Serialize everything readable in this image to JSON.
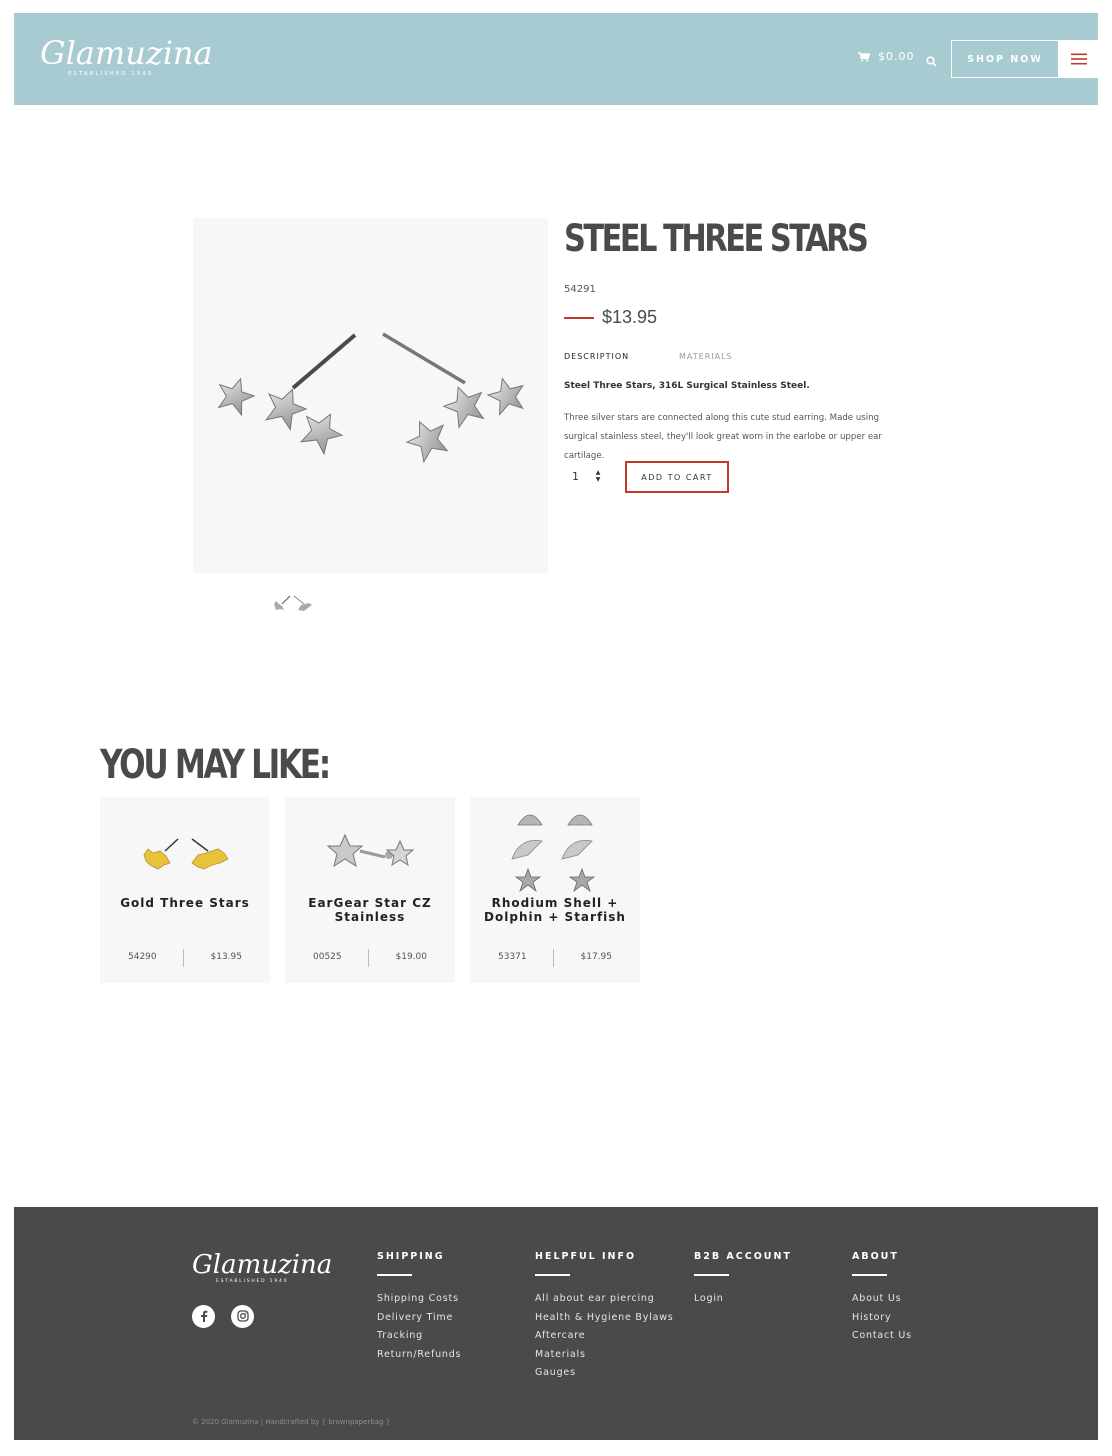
{
  "header": {
    "logo_text": "Glamuzina",
    "logo_tagline": "ESTABLISHED 1940",
    "cart_total": "$0.00",
    "shop_now_label": "SHOP NOW"
  },
  "product": {
    "title": "STEEL THREE STARS",
    "sku": "54291",
    "price": "$13.95",
    "tabs": [
      {
        "label": "DESCRIPTION",
        "active": true
      },
      {
        "label": "MATERIALS",
        "active": false
      }
    ],
    "short_description": "Steel Three Stars, 316L Surgical Stainless Steel.",
    "long_description": "Three silver stars are connected along this cute stud earring. Made using surgical stainless steel, they'll look great worn in the earlobe or upper ear cartilage.",
    "quantity": "1",
    "add_to_cart_label": "ADD TO CART"
  },
  "related": {
    "title": "YOU MAY LIKE:",
    "items": [
      {
        "name": "Gold Three Stars",
        "sku": "54290",
        "price": "$13.95"
      },
      {
        "name": "EarGear Star CZ Stainless",
        "sku": "00525",
        "price": "$19.00"
      },
      {
        "name": "Rhodium Shell + Dolphin + Starfish",
        "sku": "53371",
        "price": "$17.95"
      }
    ]
  },
  "footer": {
    "logo_text": "Glamuzina",
    "logo_tagline": "ESTABLISHED 1940",
    "columns": [
      {
        "heading": "SHIPPING",
        "links": [
          "Shipping Costs",
          "Delivery Time",
          "Tracking",
          "Return/Refunds"
        ]
      },
      {
        "heading": "HELPFUL INFO",
        "links": [
          "All about ear piercing",
          "Health & Hygiene Bylaws",
          "Aftercare",
          "Materials",
          "Gauges"
        ]
      },
      {
        "heading": "B2B ACCOUNT",
        "links": [
          "Login"
        ]
      },
      {
        "heading": "ABOUT",
        "links": [
          "About Us",
          "History",
          "Contact Us"
        ]
      }
    ],
    "copyright": "© 2020 Glamuzina | Handcrafted by { brownpaperbag }"
  },
  "colors": {
    "header_bg": "#a7cbd0",
    "accent_red": "#c0392b",
    "footer_bg": "#4a4a4a",
    "card_bg": "#f7f7f7"
  },
  "icons": [
    "cart-icon",
    "search-icon",
    "hamburger-icon",
    "facebook-icon",
    "instagram-icon"
  ]
}
